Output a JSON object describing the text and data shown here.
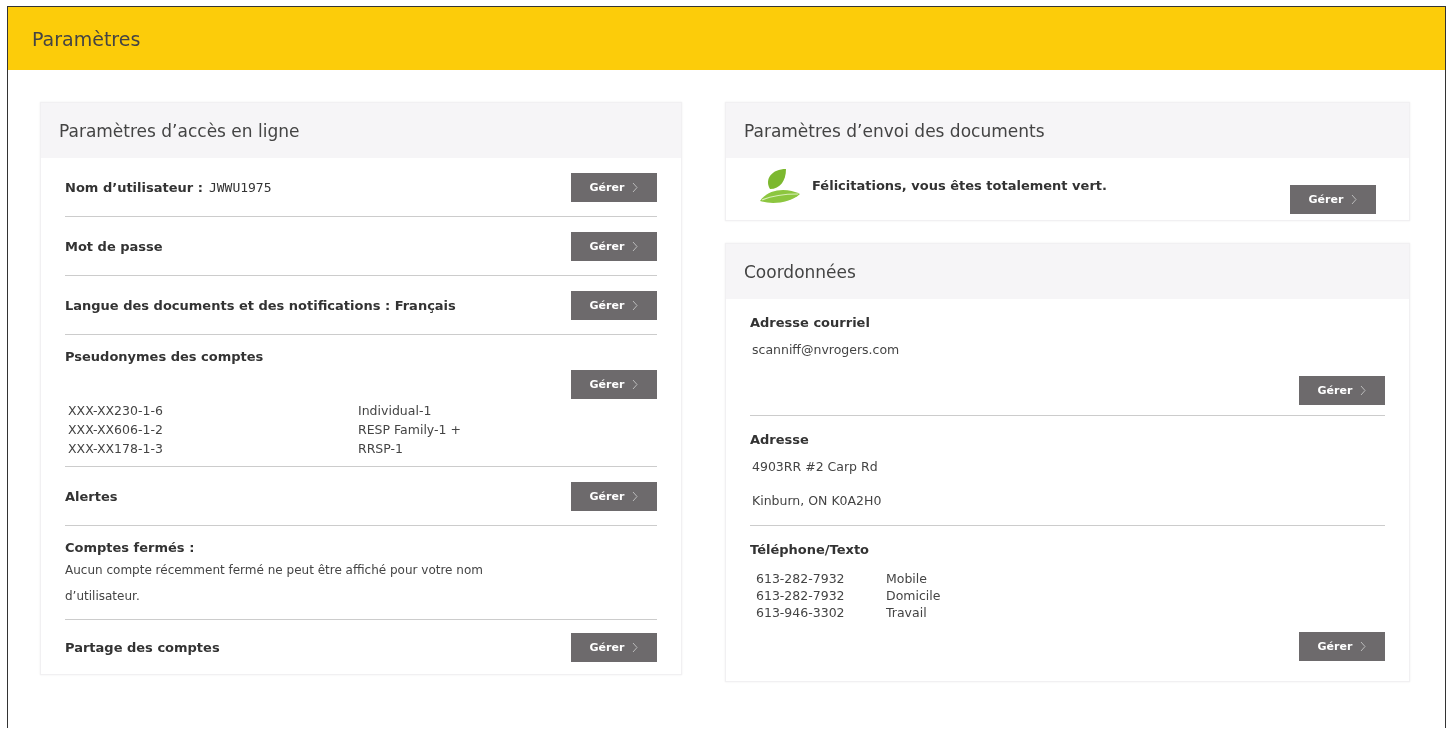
{
  "header": {
    "title": "Paramètres"
  },
  "online_access": {
    "title": "Paramètres d’accès en ligne",
    "rows": [
      {
        "kind": "setting",
        "label": "Nom d’utilisateur :",
        "value": "JWWU1975",
        "button": "Gérer"
      },
      {
        "kind": "setting",
        "label": "Mot de passe",
        "button": "Gérer"
      },
      {
        "kind": "setting",
        "label": "Langue des documents et des notifications : Français",
        "button": "Gérer"
      },
      {
        "kind": "aliases",
        "label": "Pseudonymes des comptes",
        "button": "Gérer",
        "accounts": [
          {
            "number": "XXX-XX230-1-6",
            "alias": "Individual-1"
          },
          {
            "number": "XXX-XX606-1-2",
            "alias": "RESP Family-1 +"
          },
          {
            "number": "XXX-XX178-1-3",
            "alias": "RRSP-1"
          }
        ]
      },
      {
        "kind": "setting",
        "label": "Alertes",
        "button": "Gérer"
      },
      {
        "kind": "note",
        "label": "Comptes fermés :",
        "text": "Aucun compte récemment fermé ne peut être affiché pour votre nom d’utilisateur."
      },
      {
        "kind": "setting",
        "label": "Partage des comptes",
        "button": "Gérer"
      }
    ]
  },
  "delivery": {
    "title": "Paramètres d’envoi des documents",
    "message": "Félicitations, vous êtes totalement vert.",
    "button": "Gérer"
  },
  "contact": {
    "title": "Coordonnées",
    "sections": [
      {
        "kind": "lines",
        "label": "Adresse courriel",
        "lines": [
          "scanniff@nvrogers.com"
        ],
        "button": "Gérer"
      },
      {
        "kind": "lines",
        "label": "Adresse",
        "lines": [
          "4903RR #2 Carp Rd",
          "Kinburn, ON K0A2H0"
        ]
      },
      {
        "kind": "phones",
        "label": "Téléphone/Texto",
        "phones": [
          {
            "number": "613-282-7932",
            "type": "Mobile"
          },
          {
            "number": "613-282-7932",
            "type": "Domicile"
          },
          {
            "number": "613-946-3302",
            "type": "Travail"
          }
        ],
        "button": "Gérer"
      }
    ]
  }
}
